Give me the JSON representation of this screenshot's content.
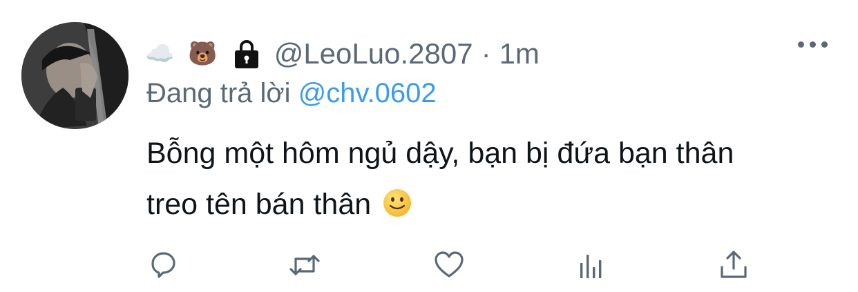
{
  "tweet": {
    "header": {
      "emojis": [
        "☁️",
        "🐻"
      ],
      "handle": "@LeoLuo.2807",
      "separator": "·",
      "time": "1m"
    },
    "reply": {
      "prefix": "Đang trả lời",
      "mention": "@chv.0602"
    },
    "text_line1": "Bỗng một hôm ngủ dậy, bạn bị đứa bạn thân",
    "text_line2": "treo tên bán thân",
    "actions": [
      "reply-icon",
      "retweet-icon",
      "like-icon",
      "analytics-icon",
      "share-icon"
    ],
    "colors": {
      "secondary_text": "#5b6875",
      "mention": "#3a9bf2",
      "body_text": "#0f1419"
    }
  }
}
